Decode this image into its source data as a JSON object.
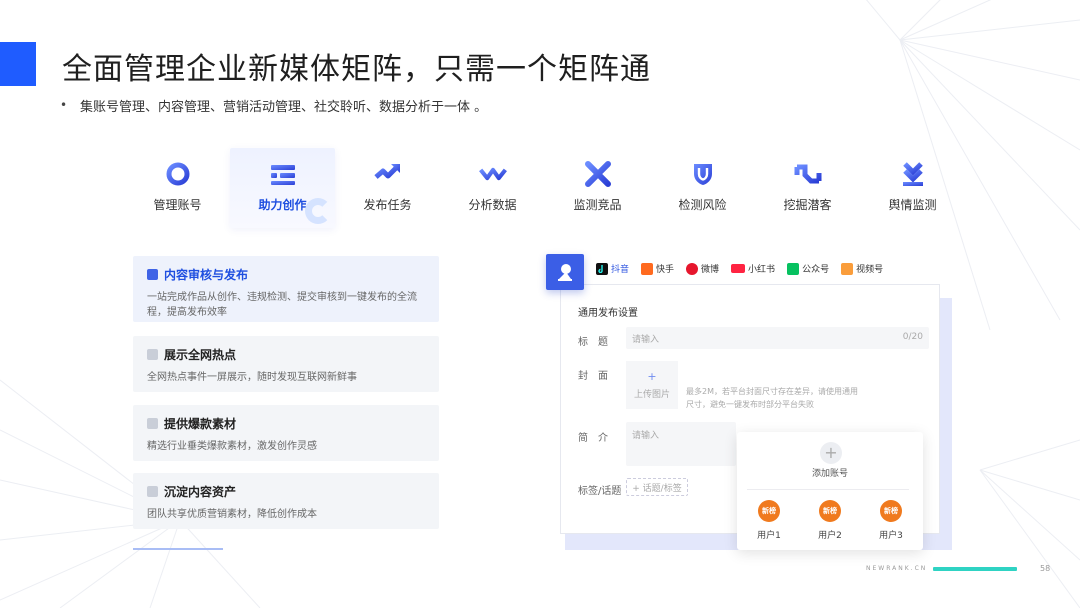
{
  "slide": {
    "title": "全面管理企业新媒体矩阵，只需一个矩阵通",
    "bullet": "•",
    "subtitle": "集账号管理、内容管理、营销活动管理、社交聆听、数据分析于一体 。"
  },
  "features": [
    {
      "label": "管理账号",
      "icon": "ring-icon",
      "active": false
    },
    {
      "label": "助力创作",
      "icon": "bars-icon",
      "active": true
    },
    {
      "label": "发布任务",
      "icon": "trend-arrow-icon",
      "active": false
    },
    {
      "label": "分析数据",
      "icon": "wave-icon",
      "active": false
    },
    {
      "label": "监测竞品",
      "icon": "cross-icon",
      "active": false
    },
    {
      "label": "检测风险",
      "icon": "shield-icon",
      "active": false
    },
    {
      "label": "挖掘潜客",
      "icon": "link-icon",
      "active": false
    },
    {
      "label": "舆情监测",
      "icon": "download-icon",
      "active": false
    }
  ],
  "cards": [
    {
      "title": "内容审核与发布",
      "desc": "一站完成作品从创作、违规检测、提交审核到一键发布的全流程，提高发布效率",
      "active": true
    },
    {
      "title": "展示全网热点",
      "desc": "全网热点事件一屏展示，随时发现互联网新鲜事",
      "active": false
    },
    {
      "title": "提供爆款素材",
      "desc": "精选行业垂类爆款素材，激发创作灵感",
      "active": false
    },
    {
      "title": "沉淀内容资产",
      "desc": "团队共享优质营销素材，降低创作成本",
      "active": false
    }
  ],
  "mockup": {
    "platforms": [
      {
        "label": "抖音",
        "icon": "douyin-icon",
        "color": "#111111",
        "active": true
      },
      {
        "label": "快手",
        "icon": "kuaishou-icon",
        "color": "#ff6a1f",
        "active": false
      },
      {
        "label": "微博",
        "icon": "weibo-icon",
        "color": "#e6162d",
        "active": false
      },
      {
        "label": "小红书",
        "icon": "xiaohongshu-icon",
        "color": "#ff2442",
        "active": false
      },
      {
        "label": "公众号",
        "icon": "wechat-icon",
        "color": "#07c160",
        "active": false
      },
      {
        "label": "视频号",
        "icon": "channels-icon",
        "color": "#fa9d3b",
        "active": false
      }
    ],
    "section_title": "通用发布设置",
    "title_label": "标　题",
    "title_placeholder": "请输入",
    "title_count": "0/20",
    "cover_label": "封　面",
    "upload_plus": "+",
    "upload_label": "上传图片",
    "upload_hint": "最多2M，若平台封面尺寸存在差异，请使用通用尺寸，避免一键发布时部分平台失败",
    "intro_label": "简　介",
    "intro_placeholder": "请输入",
    "tags_label": "标签/话题",
    "tags_button": "+ 话题/标签",
    "popup": {
      "add_icon": "+",
      "add_label": "添加账号",
      "users": [
        {
          "name": "用户1",
          "avatar_text": "新榜"
        },
        {
          "name": "用户2",
          "avatar_text": "新榜"
        },
        {
          "name": "用户3",
          "avatar_text": "新榜"
        }
      ]
    }
  },
  "footer": {
    "brand": "NEWRANK.CN",
    "page": "58"
  },
  "colors": {
    "accent": "#1f5cff",
    "icon_gradient_start": "#6b8cff",
    "icon_gradient_end": "#2b3fd6",
    "teal_bar": "#2fd3c3",
    "avatar_orange": "#f07a1e"
  }
}
